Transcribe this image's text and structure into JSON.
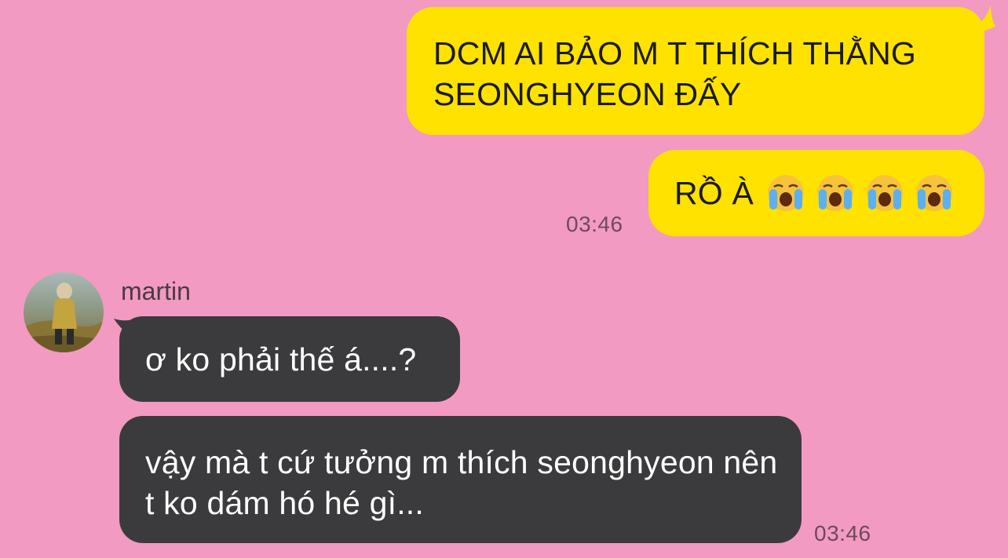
{
  "messages": [
    {
      "text": "DCM AI BẢO M T THÍCH THẰNG SEONGHYEON ĐẤY",
      "direction": "outgoing"
    },
    {
      "text": "RỒ À",
      "direction": "outgoing",
      "emojis": [
        "loudly-crying-face",
        "loudly-crying-face",
        "loudly-crying-face",
        "loudly-crying-face"
      ]
    },
    {
      "text": "ơ ko phải thế á....?",
      "direction": "incoming"
    },
    {
      "text": "vậy mà t cứ tưởng m thích seonghyeon nên t ko dám hó hé gì...",
      "direction": "incoming"
    }
  ],
  "timestamps": {
    "outgoing": "03:46",
    "incoming": "03:46"
  },
  "sender": {
    "name": "martin",
    "avatar_icon": "profile-photo-avatar"
  },
  "colors": {
    "background": "#f29ac2",
    "outgoing_bubble": "#ffe200",
    "incoming_bubble": "#3b3b3d"
  }
}
